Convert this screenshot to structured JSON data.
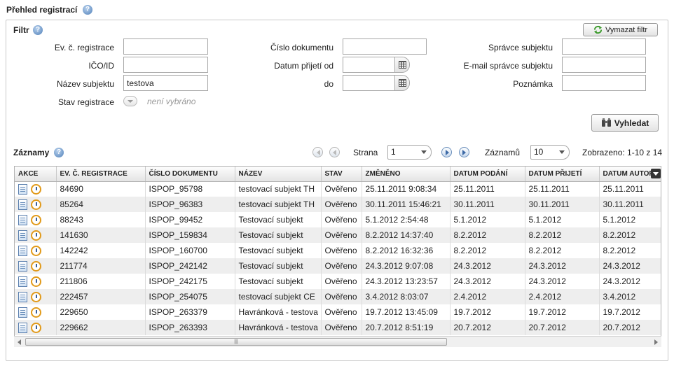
{
  "page": {
    "title": "Přehled registrací"
  },
  "filter": {
    "title": "Filtr",
    "clear_button": "Vymazat filtr",
    "search_button": "Vyhledat",
    "fields": {
      "ev_c_registrace": {
        "label": "Ev. č. registrace",
        "value": ""
      },
      "ico_id": {
        "label": "IČO/ID",
        "value": ""
      },
      "nazev_subjektu": {
        "label": "Název subjektu",
        "value": "testova"
      },
      "stav_registrace": {
        "label": "Stav registrace",
        "value": "není vybráno"
      },
      "cislo_dokumentu": {
        "label": "Číslo dokumentu",
        "value": ""
      },
      "datum_prijeti_od": {
        "label": "Datum přijetí od",
        "value": ""
      },
      "datum_prijeti_do": {
        "label": "do",
        "value": ""
      },
      "spravce_subjektu": {
        "label": "Správce subjektu",
        "value": ""
      },
      "email_spravce": {
        "label": "E-mail správce subjektu",
        "value": ""
      },
      "poznamka": {
        "label": "Poznámka",
        "value": ""
      }
    }
  },
  "records": {
    "title": "Záznamy",
    "pager": {
      "page_label": "Strana",
      "page_value": "1",
      "count_label": "Záznamů",
      "count_value": "10",
      "shown_text": "Zobrazeno: 1-10 z 14"
    },
    "columns": [
      "AKCE",
      "EV. Č. REGISTRACE",
      "ČÍSLO DOKUMENTU",
      "NÁZEV",
      "STAV",
      "ZMĚNĚNO",
      "DATUM PODÁNÍ",
      "DATUM PŘIJETÍ",
      "DATUM AUTOR"
    ],
    "rows": [
      [
        "84690",
        "ISPOP_95798",
        "testovací subjekt TH",
        "Ověřeno",
        "25.11.2011 9:08:34",
        "25.11.2011",
        "25.11.2011",
        "25.11.2011"
      ],
      [
        "85264",
        "ISPOP_96383",
        "testovací subjekt TH",
        "Ověřeno",
        "30.11.2011 15:46:21",
        "30.11.2011",
        "30.11.2011",
        "30.11.2011"
      ],
      [
        "88243",
        "ISPOP_99452",
        "Testovací subjekt",
        "Ověřeno",
        "5.1.2012 2:54:48",
        "5.1.2012",
        "5.1.2012",
        "5.1.2012"
      ],
      [
        "141630",
        "ISPOP_159834",
        "Testovací subjekt",
        "Ověřeno",
        "8.2.2012 14:37:40",
        "8.2.2012",
        "8.2.2012",
        "8.2.2012"
      ],
      [
        "142242",
        "ISPOP_160700",
        "Testovací subjekt",
        "Ověřeno",
        "8.2.2012 16:32:36",
        "8.2.2012",
        "8.2.2012",
        "8.2.2012"
      ],
      [
        "211774",
        "ISPOP_242142",
        "Testovací subjekt",
        "Ověřeno",
        "24.3.2012 9:07:08",
        "24.3.2012",
        "24.3.2012",
        "24.3.2012"
      ],
      [
        "211806",
        "ISPOP_242175",
        "Testovací subjekt",
        "Ověřeno",
        "24.3.2012 13:23:57",
        "24.3.2012",
        "24.3.2012",
        "24.3.2012"
      ],
      [
        "222457",
        "ISPOP_254075",
        "testovací subjekt CE",
        "Ověřeno",
        "3.4.2012 8:03:07",
        "2.4.2012",
        "2.4.2012",
        "3.4.2012"
      ],
      [
        "229650",
        "ISPOP_263379",
        "Havránková - testova",
        "Ověřeno",
        "19.7.2012 13:45:09",
        "19.7.2012",
        "19.7.2012",
        "19.7.2012"
      ],
      [
        "229662",
        "ISPOP_263393",
        "Havránková - testova",
        "Ověřeno",
        "20.7.2012 8:51:19",
        "20.7.2012",
        "20.7.2012",
        "20.7.2012"
      ]
    ]
  },
  "icons": {
    "help": "help-icon",
    "refresh": "refresh-icon",
    "calendar": "calendar-icon",
    "binoculars": "binoculars-icon",
    "row_detail": "document-icon",
    "row_history": "clock-icon"
  }
}
